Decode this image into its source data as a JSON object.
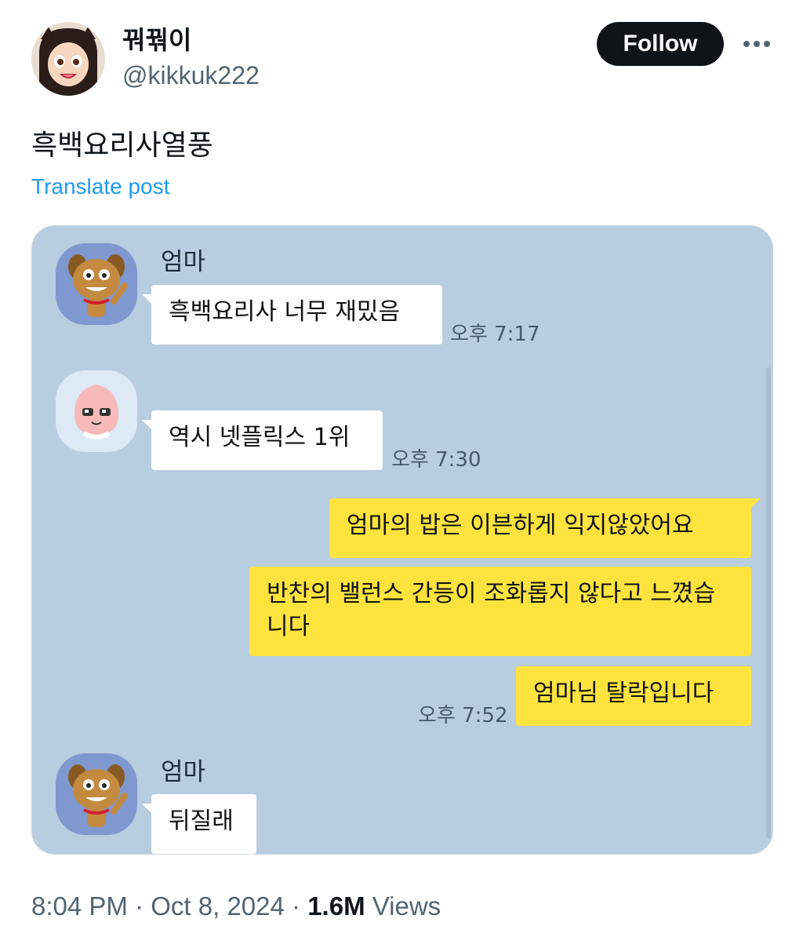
{
  "author": {
    "display_name": "꿔꿖이",
    "handle": "@kikkuk222"
  },
  "buttons": {
    "follow_label": "Follow"
  },
  "post": {
    "text": "흑백요리사열풍",
    "translate_label": "Translate post"
  },
  "chat": {
    "messages": [
      {
        "sender": "엄마",
        "text": "흑백요리사 너무 재밌음",
        "time": "오후 7:17"
      },
      {
        "text": "역시 넷플릭스 1위",
        "time": "오후 7:30"
      },
      {
        "text": "엄마의 밥은 이븐하게 익지않았어요"
      },
      {
        "text": "반찬의 밸런스 간등이 조화롭지 않다고 느꼈습니다"
      },
      {
        "text": "엄마님 탈락입니다",
        "time": "오후 7:52"
      },
      {
        "sender": "엄마",
        "text": "뒤질래"
      }
    ]
  },
  "meta": {
    "time": "8:04 PM",
    "date": "Oct 8, 2024",
    "views_count": "1.6M",
    "views_label": "Views"
  },
  "colors": {
    "chat_background": "#b8cde0",
    "my_bubble": "#fee33f",
    "their_bubble": "#ffffff",
    "link": "#1d9bf0"
  }
}
